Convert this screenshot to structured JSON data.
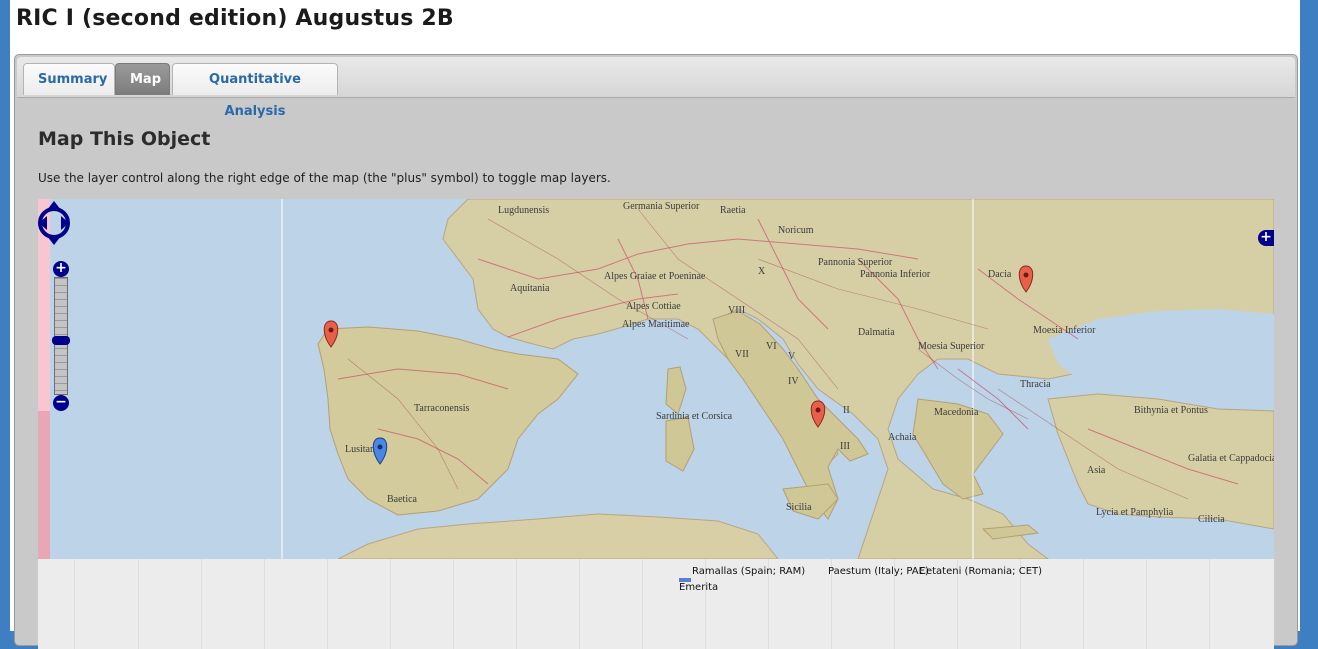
{
  "page": {
    "title": "RIC I (second edition) Augustus 2B"
  },
  "tabs": [
    {
      "label": "Summary",
      "active": false
    },
    {
      "label": "Map",
      "active": true
    },
    {
      "label": "Quantitative Analysis",
      "active": false
    }
  ],
  "map_section": {
    "heading": "Map This Object",
    "instructions": "Use the layer control along the right edge of the map (the \"plus\" symbol) to toggle map layers."
  },
  "map": {
    "region_labels": [
      "Lugdunensis",
      "Germania Superior",
      "Raetia",
      "Noricum",
      "Pannonia Superior",
      "Pannonia Inferior",
      "Dacia",
      "Aquitania",
      "Alpes Graiae et Poeninae",
      "X",
      "Alpes Cottiae",
      "Alpes Maritimae",
      "VIII",
      "Dalmatia",
      "VII",
      "VI",
      "V",
      "Moesia Superior",
      "Moesia Inferior",
      "IV",
      "Thracia",
      "Tarraconensis",
      "Sardinia et Corsica",
      "II",
      "Macedonia",
      "Bithynia et Pontus",
      "Achaia",
      "Lusitania",
      "III",
      "Asia",
      "Galatia et Cappadocia",
      "Baetica",
      "Sicilia",
      "Lycia et Pamphylia",
      "Cilicia"
    ],
    "markers": [
      {
        "name": "ramallas",
        "color": "#e8604c"
      },
      {
        "name": "paestum",
        "color": "#e8604c"
      },
      {
        "name": "cetateni",
        "color": "#e8604c"
      },
      {
        "name": "emerita",
        "color": "#4a86e8"
      }
    ]
  },
  "timeline": {
    "findspots": [
      "Ramallas (Spain; RAM)",
      "Paestum (Italy; PAE)",
      "Cetateni (Romania; CET)"
    ],
    "mint": "Emerita",
    "mint_color": "#5b7fd0"
  },
  "colors": {
    "accent": "#3d7fc0",
    "tab_text": "#2a6aa8",
    "control_blue": "#00008b"
  }
}
